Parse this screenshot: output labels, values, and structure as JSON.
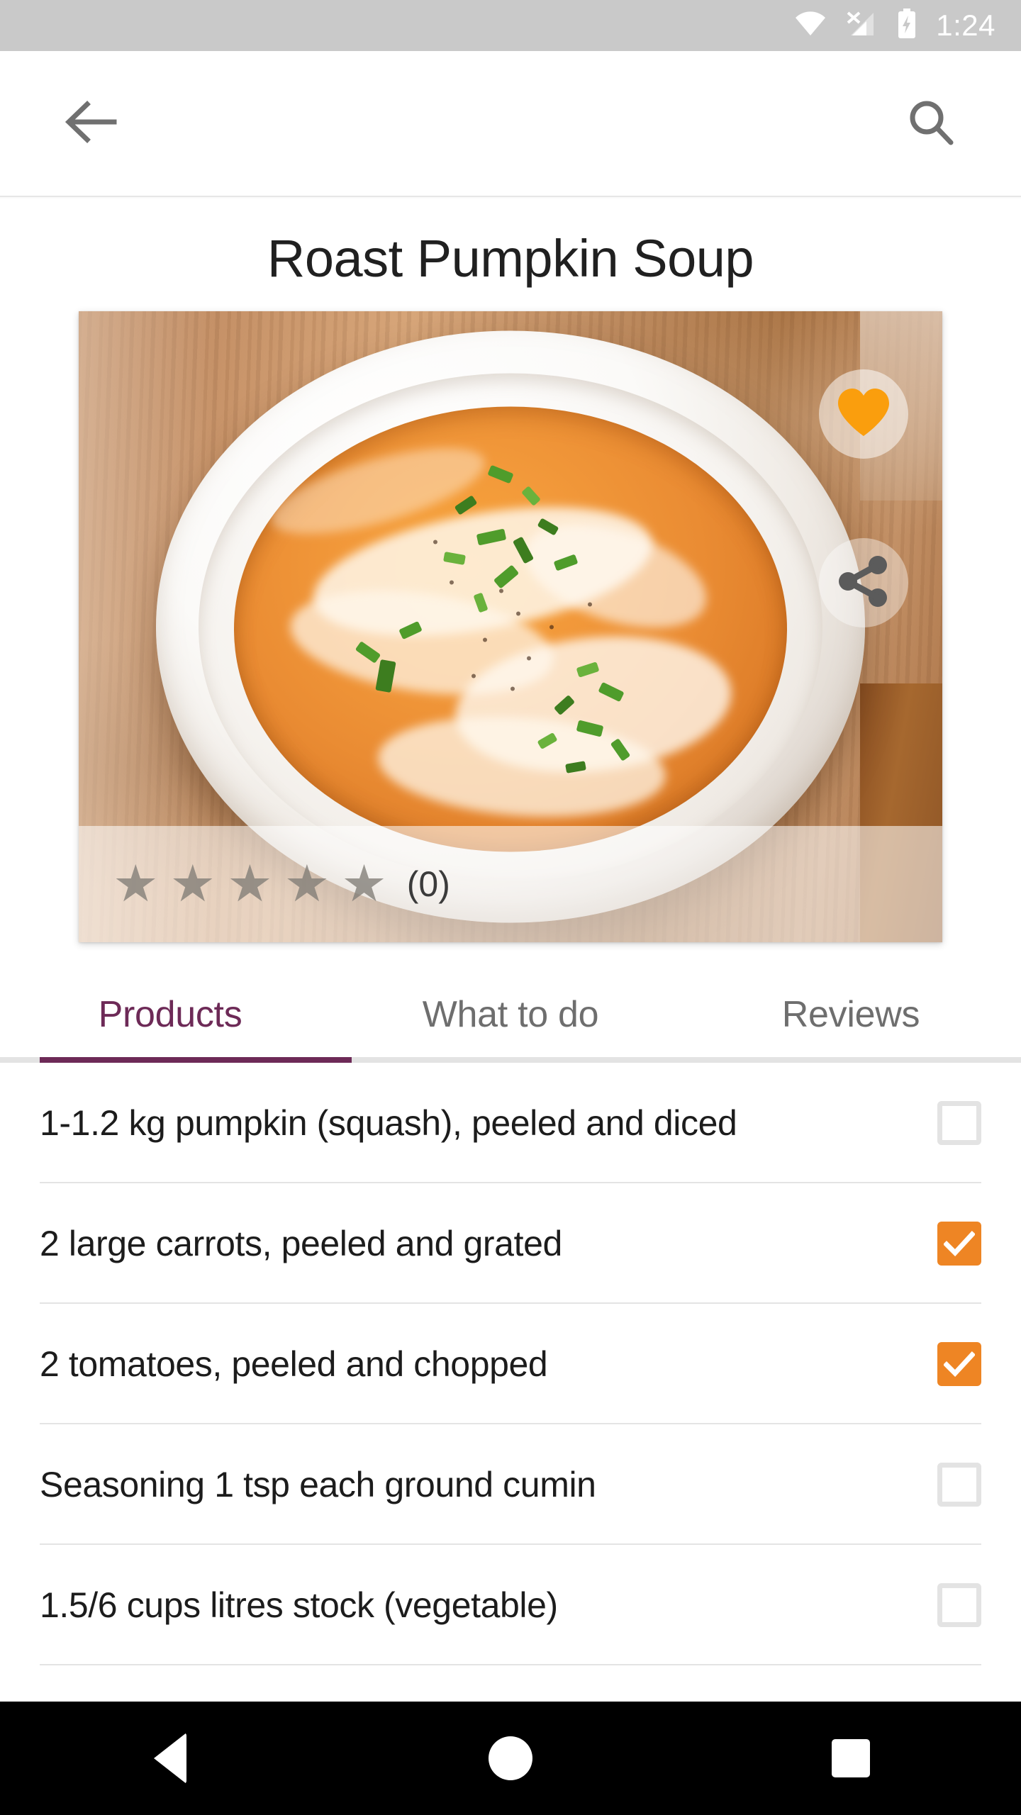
{
  "statusbar": {
    "time": "1:24",
    "icons": [
      "wifi-icon",
      "cellular-off-icon",
      "battery-charging-icon"
    ]
  },
  "toolbar": {
    "back_label": "back-arrow",
    "search_label": "search"
  },
  "recipe": {
    "title": "Roast Pumpkin Soup",
    "favorite_active": true,
    "favorite_color": "#fa9e0d",
    "share_color": "#5b5b5b",
    "rating": {
      "stars_total": 5,
      "stars_filled": 0,
      "star_glyph": "★",
      "count_label": "(0)"
    }
  },
  "tabs": {
    "active_index": 0,
    "accent_color": "#6d2a57",
    "items": [
      {
        "label": "Products"
      },
      {
        "label": "What to do"
      },
      {
        "label": "Reviews"
      }
    ]
  },
  "ingredients": {
    "checkbox_on_color": "#ee8524",
    "items": [
      {
        "label": "1-1.2 kg pumpkin (squash), peeled and diced",
        "checked": false
      },
      {
        "label": "2 large carrots, peeled and grated",
        "checked": true
      },
      {
        "label": "2 tomatoes, peeled and chopped",
        "checked": true
      },
      {
        "label": "Seasoning 1 tsp each ground cumin",
        "checked": false
      },
      {
        "label": "1.5/6 cups litres stock (vegetable)",
        "checked": false
      }
    ]
  },
  "navbar": {
    "back_label": "back",
    "home_label": "home",
    "recents_label": "recents"
  }
}
